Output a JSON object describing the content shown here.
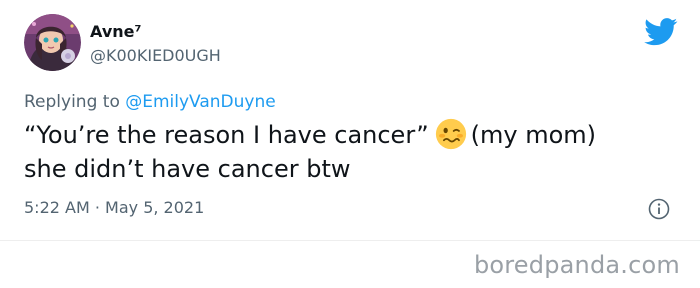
{
  "author": {
    "display_name": "Avne⁷",
    "handle": "@K00KIED0UGH",
    "avatar": "avatar-illustration"
  },
  "reply": {
    "prefix": "Replying to ",
    "mention": "@EmilyVanDuyne"
  },
  "tweet": {
    "line1_before_emoji": "“You’re the reason I have cancer”",
    "emoji": "woozy-face-icon",
    "line1_after_emoji": "(my mom)",
    "line2": "she didn’t have cancer btw"
  },
  "meta": {
    "timestamp": "5:22 AM · May 5, 2021"
  },
  "icons": {
    "brand": "twitter-bird-icon",
    "info": "info-icon"
  },
  "colors": {
    "twitter_blue": "#1d9bf0",
    "secondary_text": "#536471",
    "primary_text": "#0f1419"
  },
  "watermark": {
    "text": "boredpanda.com"
  }
}
